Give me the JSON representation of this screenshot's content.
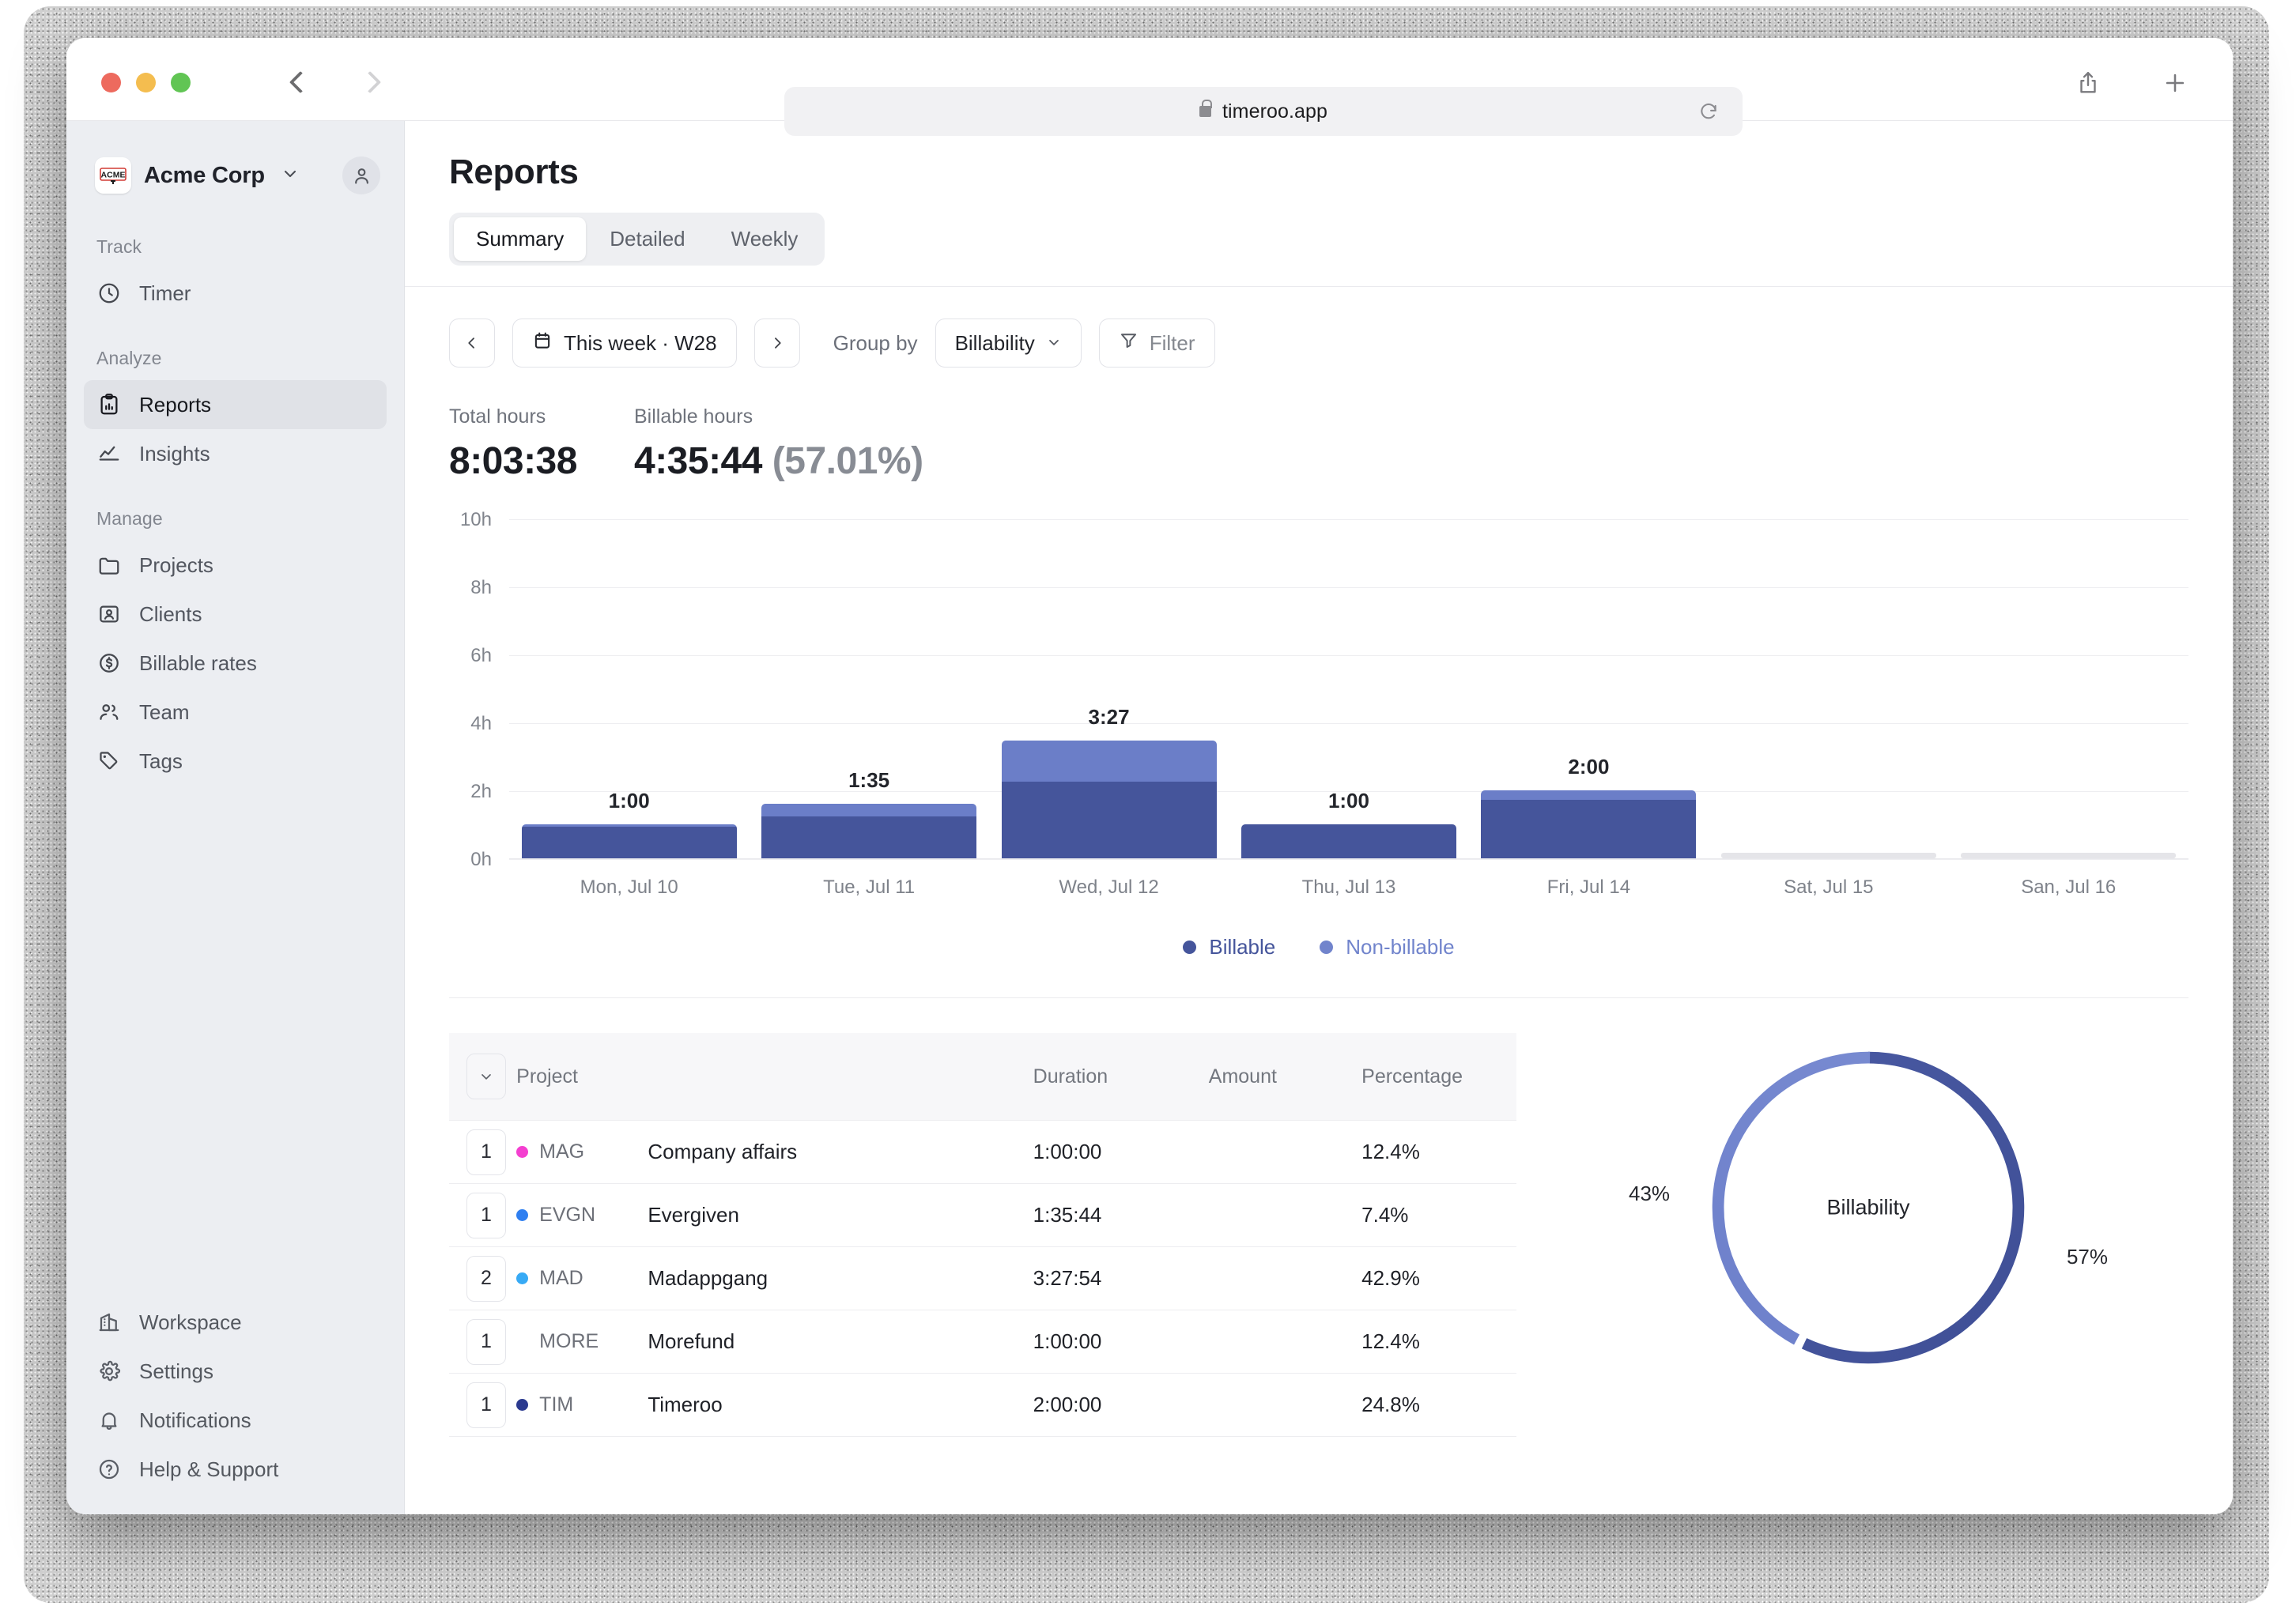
{
  "browser": {
    "url": "timeroo.app",
    "lock_icon": "lock-icon",
    "reload_icon": "reload-icon",
    "back_icon": "chevron-left-icon",
    "forward_icon": "chevron-right-icon",
    "share_icon": "share-icon",
    "newtab_icon": "plus-icon"
  },
  "sidebar": {
    "workspace": {
      "name": "Acme Corp",
      "logo_text": "ACME",
      "caret_icon": "chevron-down-icon",
      "avatar_icon": "user-icon"
    },
    "groups": [
      {
        "label": "Track",
        "items": [
          {
            "label": "Timer",
            "icon": "clock-icon",
            "active": false
          }
        ]
      },
      {
        "label": "Analyze",
        "items": [
          {
            "label": "Reports",
            "icon": "clipboard-chart-icon",
            "active": true
          },
          {
            "label": "Insights",
            "icon": "line-chart-icon",
            "active": false
          }
        ]
      },
      {
        "label": "Manage",
        "items": [
          {
            "label": "Projects",
            "icon": "folder-icon",
            "active": false
          },
          {
            "label": "Clients",
            "icon": "id-card-icon",
            "active": false
          },
          {
            "label": "Billable rates",
            "icon": "dollar-circle-icon",
            "active": false
          },
          {
            "label": "Team",
            "icon": "users-icon",
            "active": false
          },
          {
            "label": "Tags",
            "icon": "tag-icon",
            "active": false
          }
        ]
      }
    ],
    "bottom_items": [
      {
        "label": "Workspace",
        "icon": "building-icon"
      },
      {
        "label": "Settings",
        "icon": "gear-icon"
      },
      {
        "label": "Notifications",
        "icon": "bell-icon"
      },
      {
        "label": "Help & Support",
        "icon": "question-circle-icon"
      }
    ]
  },
  "page": {
    "title": "Reports",
    "tabs": [
      {
        "label": "Summary",
        "active": true
      },
      {
        "label": "Detailed",
        "active": false
      },
      {
        "label": "Weekly",
        "active": false
      }
    ]
  },
  "toolbar": {
    "prev_icon": "chevron-left-icon",
    "next_icon": "chevron-right-icon",
    "calendar_icon": "calendar-icon",
    "date_range": "This week · W28",
    "group_by_label": "Group by",
    "group_by_value": "Billability",
    "group_by_caret": "chevron-down-icon",
    "filter_icon": "filter-icon",
    "filter_label": "Filter"
  },
  "stats": {
    "total_hours_label": "Total hours",
    "total_hours_value": "8:03:38",
    "billable_hours_label": "Billable hours",
    "billable_hours_value": "4:35:44",
    "billable_hours_pct": "(57.01%)"
  },
  "chart_data": {
    "type": "bar",
    "title": "",
    "xlabel": "",
    "ylabel": "",
    "grid": true,
    "stacked": true,
    "ylim": [
      0,
      10
    ],
    "yticks": [
      "0h",
      "2h",
      "4h",
      "6h",
      "8h",
      "10h"
    ],
    "ytick_values": [
      0,
      2,
      4,
      6,
      8,
      10
    ],
    "categories": [
      "Mon, Jul 10",
      "Tue, Jul 11",
      "Wed, Jul 12",
      "Thu, Jul 13",
      "Fri, Jul 14",
      "Sat, Jul 15",
      "San, Jul 16"
    ],
    "bar_labels": [
      "1:00",
      "1:35",
      "3:27",
      "1:00",
      "2:00",
      "",
      ""
    ],
    "totals_hours": [
      1.0,
      1.595,
      3.465,
      1.0,
      2.0,
      0,
      0
    ],
    "series": [
      {
        "name": "Billable",
        "color": "#45559b",
        "values": [
          0.93,
          1.23,
          2.25,
          1.0,
          1.72,
          0,
          0
        ]
      },
      {
        "name": "Non-billable",
        "color": "#6b7ec8",
        "values": [
          0.07,
          0.365,
          1.215,
          0.0,
          0.28,
          0,
          0
        ]
      }
    ],
    "legend": [
      {
        "label": "Billable",
        "color": "#45559b"
      },
      {
        "label": "Non-billable",
        "color": "#7184cc"
      }
    ],
    "legend_position": "bottom"
  },
  "table": {
    "collapse_icon": "chevron-down-icon",
    "columns": [
      "Project",
      "Duration",
      "Amount",
      "Percentage"
    ],
    "rows": [
      {
        "count": "1",
        "dot_color": "#f43fd0",
        "code": "MAG",
        "name": "Company affairs",
        "duration": "1:00:00",
        "amount": "",
        "percentage": "12.4%"
      },
      {
        "count": "1",
        "dot_color": "#2f7ff0",
        "code": "EVGN",
        "name": "Evergiven",
        "duration": "1:35:44",
        "amount": "",
        "percentage": "7.4%"
      },
      {
        "count": "2",
        "dot_color": "#37aaf5",
        "code": "MAD",
        "name": "Madappgang",
        "duration": "3:27:54",
        "amount": "",
        "percentage": "42.9%"
      },
      {
        "count": "1",
        "dot_color": "#f5b battery",
        "code": "MORE",
        "name": "Morefund",
        "duration": "1:00:00",
        "amount": "",
        "percentage": "12.4%"
      },
      {
        "count": "1",
        "dot_color": "#2b3a8f",
        "code": "TIM",
        "name": "Timeroo",
        "duration": "2:00:00",
        "amount": "",
        "percentage": "24.8%"
      }
    ]
  },
  "donut_chart": {
    "type": "pie",
    "title": "Billability",
    "center_label": "Billability",
    "categories": [
      "Billable",
      "Non-billable"
    ],
    "values": [
      57,
      43
    ],
    "labels": [
      "57%",
      "43%"
    ],
    "colors": [
      "#45559b",
      "#6b7ec8"
    ],
    "left_label": "43%",
    "right_label": "57%"
  }
}
